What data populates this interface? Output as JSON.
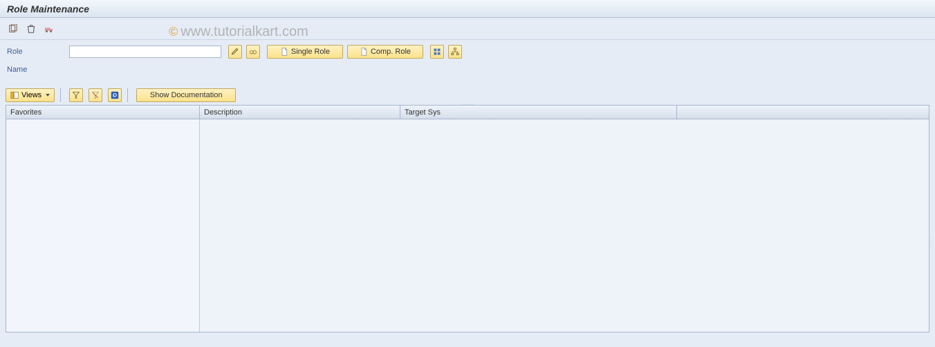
{
  "header": {
    "title": "Role Maintenance"
  },
  "top_icons": {
    "copy": "copy-icon",
    "trash": "trash-icon",
    "transport": "transport-icon"
  },
  "form": {
    "role_label": "Role",
    "role_value": "",
    "name_label": "Name",
    "name_value": ""
  },
  "role_buttons": {
    "edit_tip": "Change",
    "display_tip": "Display",
    "single_role": "Single Role",
    "comp_role": "Comp. Role"
  },
  "toolbar2": {
    "views_label": "Views",
    "show_doc": "Show Documentation"
  },
  "grid": {
    "columns": {
      "favorites": "Favorites",
      "description": "Description",
      "target_sys": "Target Sys"
    }
  },
  "watermark": "www.tutorialkart.com"
}
